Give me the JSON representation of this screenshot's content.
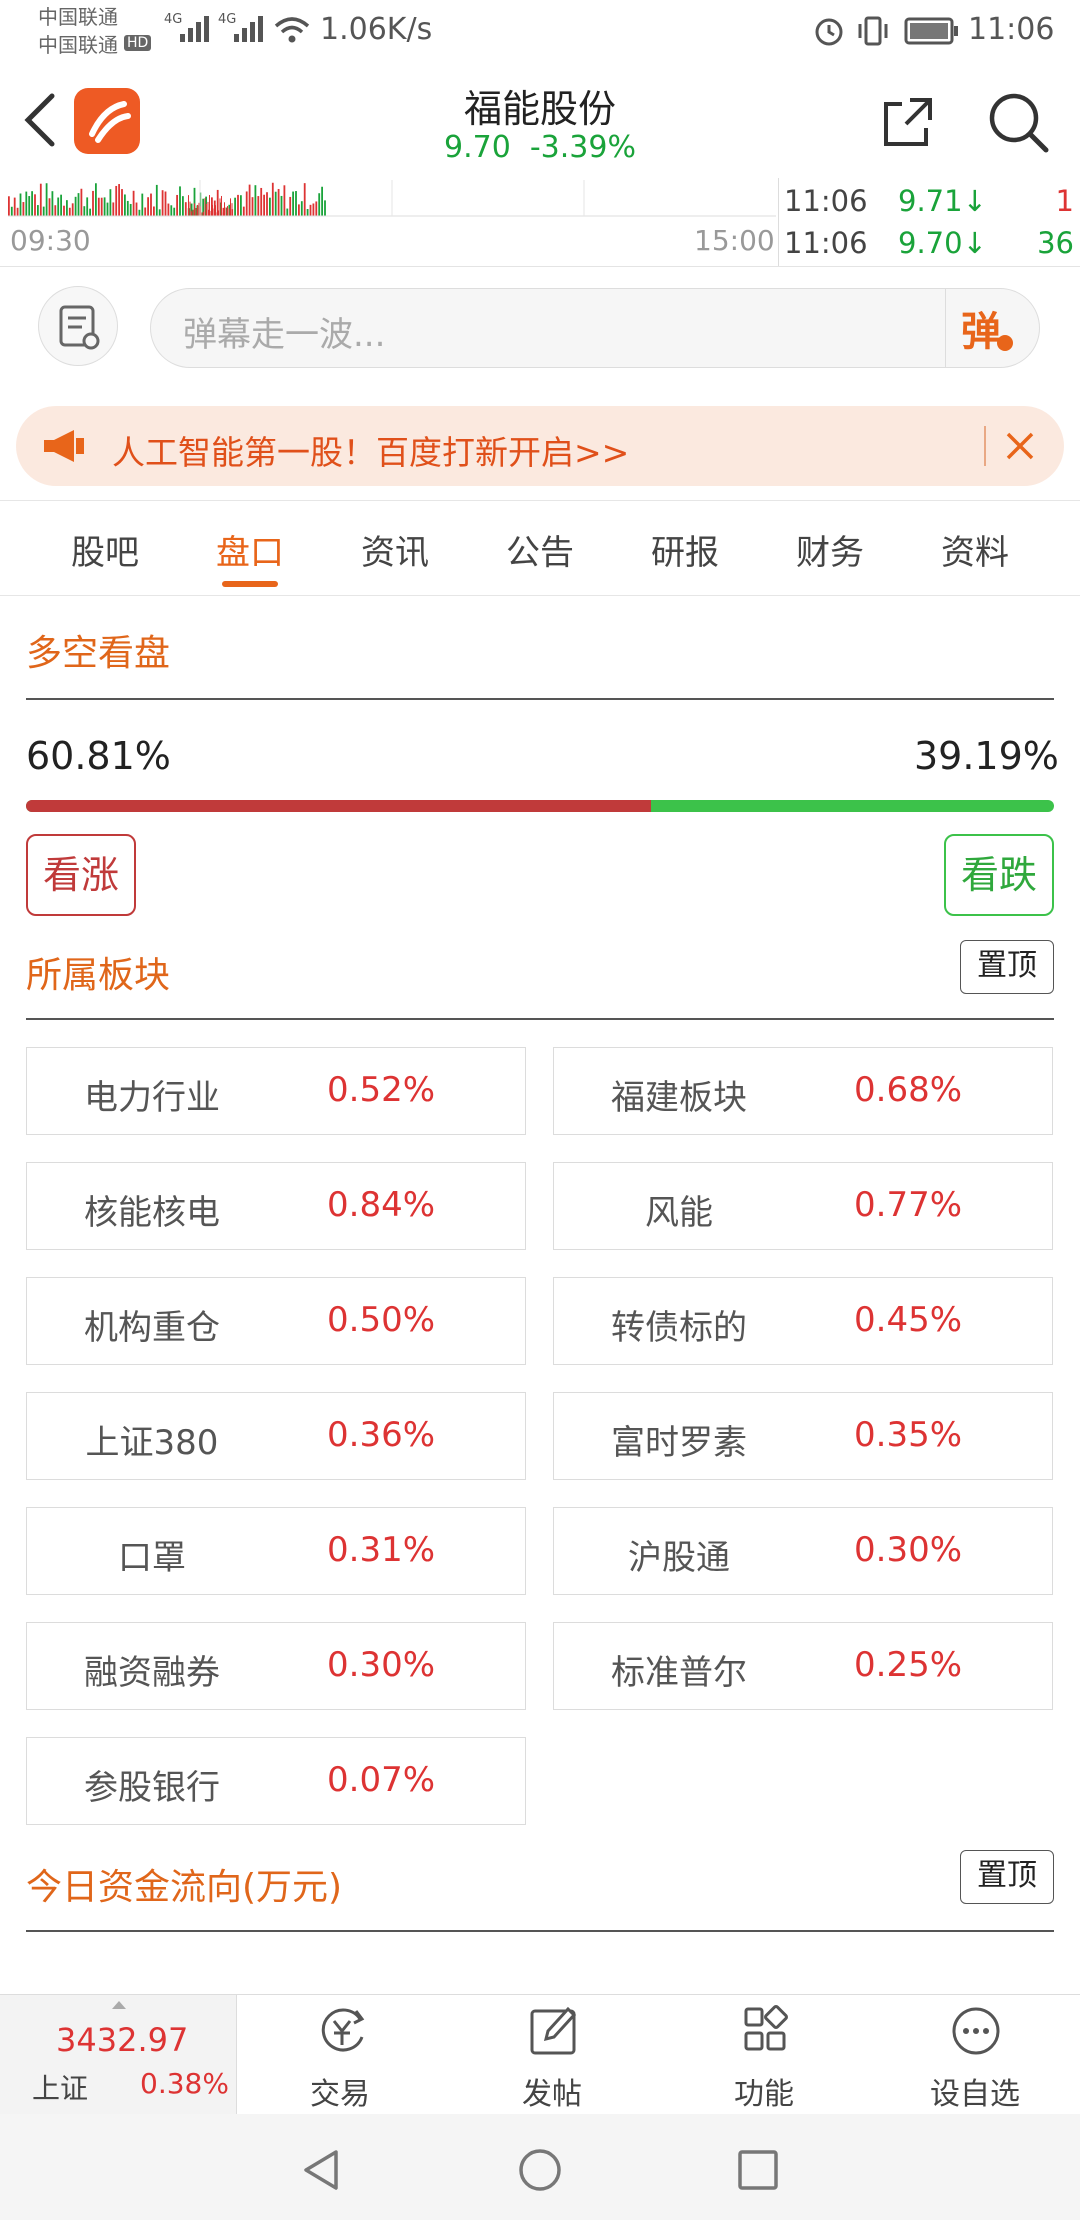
{
  "status_bar": {
    "carrier1": "中国联通",
    "carrier2": "中国联通",
    "hd": "HD",
    "net1": "4G",
    "net2": "4G",
    "speed": "1.06K/s",
    "time": "11:06"
  },
  "header": {
    "title": "福能股份",
    "price": "9.70",
    "change": "-3.39%"
  },
  "mini_chart": {
    "open_time": "09:30",
    "close_time": "15:00",
    "ticks": [
      {
        "time": "11:06",
        "price": "9.71↓",
        "vol": "1"
      },
      {
        "time": "11:06",
        "price": "9.70↓",
        "vol": "36"
      }
    ]
  },
  "danmaku": {
    "placeholder": "弹幕走一波...",
    "button": "弹"
  },
  "banner": {
    "text": "人工智能第一股！百度打新开启>>"
  },
  "tabs": [
    "股吧",
    "盘口",
    "资讯",
    "公告",
    "研报",
    "财务",
    "资料"
  ],
  "sentiment": {
    "title": "多空看盘",
    "bull_pct": "60.81%",
    "bear_pct": "39.19%",
    "bull_fraction": 0.6081,
    "bull_label": "看涨",
    "bear_label": "看跌",
    "bull_color": "#c03a3a",
    "bear_color": "#3cc24a"
  },
  "sectors": {
    "title": "所属板块",
    "pin_label": "置顶",
    "items": [
      {
        "name": "电力行业",
        "value": "0.52%"
      },
      {
        "name": "福建板块",
        "value": "0.68%"
      },
      {
        "name": "核能核电",
        "value": "0.84%"
      },
      {
        "name": "风能",
        "value": "0.77%"
      },
      {
        "name": "机构重仓",
        "value": "0.50%"
      },
      {
        "name": "转债标的",
        "value": "0.45%"
      },
      {
        "name": "上证380",
        "value": "0.36%"
      },
      {
        "name": "富时罗素",
        "value": "0.35%"
      },
      {
        "name": "口罩",
        "value": "0.31%"
      },
      {
        "name": "沪股通",
        "value": "0.30%"
      },
      {
        "name": "融资融券",
        "value": "0.30%"
      },
      {
        "name": "标准普尔",
        "value": "0.25%"
      },
      {
        "name": "参股银行",
        "value": "0.07%"
      }
    ]
  },
  "fund_flow": {
    "title": "今日资金流向(万元)",
    "pin_label": "置顶"
  },
  "bottom_bar": {
    "index_value": "3432.97",
    "index_name": "上证",
    "index_change": "0.38%",
    "items": [
      "交易",
      "发帖",
      "功能",
      "设自选"
    ]
  },
  "colors": {
    "accent": "#e8651a",
    "up": "#d33333",
    "down": "#1aa33a"
  }
}
